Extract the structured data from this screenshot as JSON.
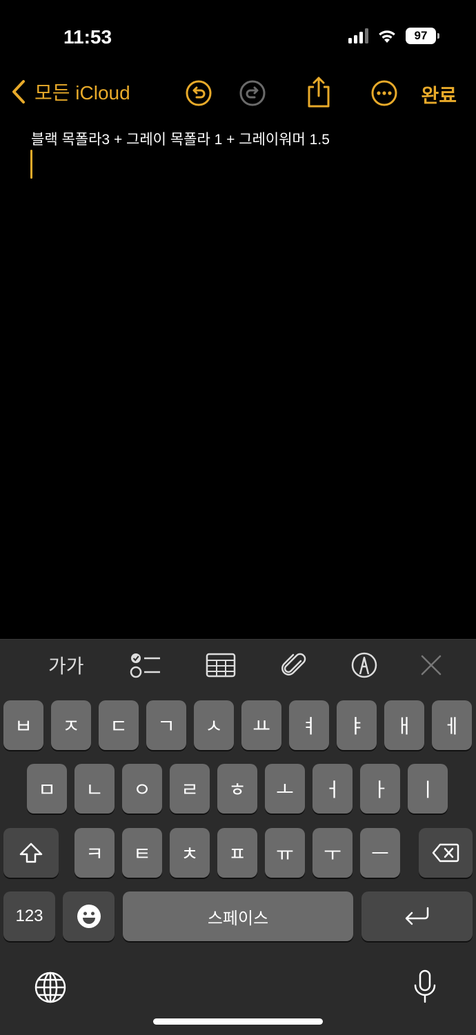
{
  "status": {
    "time": "11:53",
    "battery": "97"
  },
  "nav": {
    "back_label": "모든 iCloud",
    "done_label": "완료",
    "back_icon": "chevron-left-icon",
    "undo_icon": "undo-icon",
    "redo_icon": "redo-icon",
    "share_icon": "share-icon",
    "more_icon": "more-icon"
  },
  "note": {
    "text": "블랙 목폴라3 + 그레이 목폴라 1 + 그레이워머 1.5"
  },
  "toolbar": {
    "format_label": "가가"
  },
  "keyboard": {
    "row1": [
      "ㅂ",
      "ㅈ",
      "ㄷ",
      "ㄱ",
      "ㅅ",
      "ㅛ",
      "ㅕ",
      "ㅑ",
      "ㅐ",
      "ㅔ"
    ],
    "row2": [
      "ㅁ",
      "ㄴ",
      "ㅇ",
      "ㄹ",
      "ㅎ",
      "ㅗ",
      "ㅓ",
      "ㅏ",
      "ㅣ"
    ],
    "row3": [
      "ㅋ",
      "ㅌ",
      "ㅊ",
      "ㅍ",
      "ㅠ",
      "ㅜ",
      "ㅡ"
    ],
    "numbers_label": "123",
    "space_label": "스페이스"
  },
  "colors": {
    "accent": "#e8aa2a",
    "key": "#6b6b6b",
    "key_fn": "#474747",
    "keyboard_bg": "#2b2b2b"
  }
}
